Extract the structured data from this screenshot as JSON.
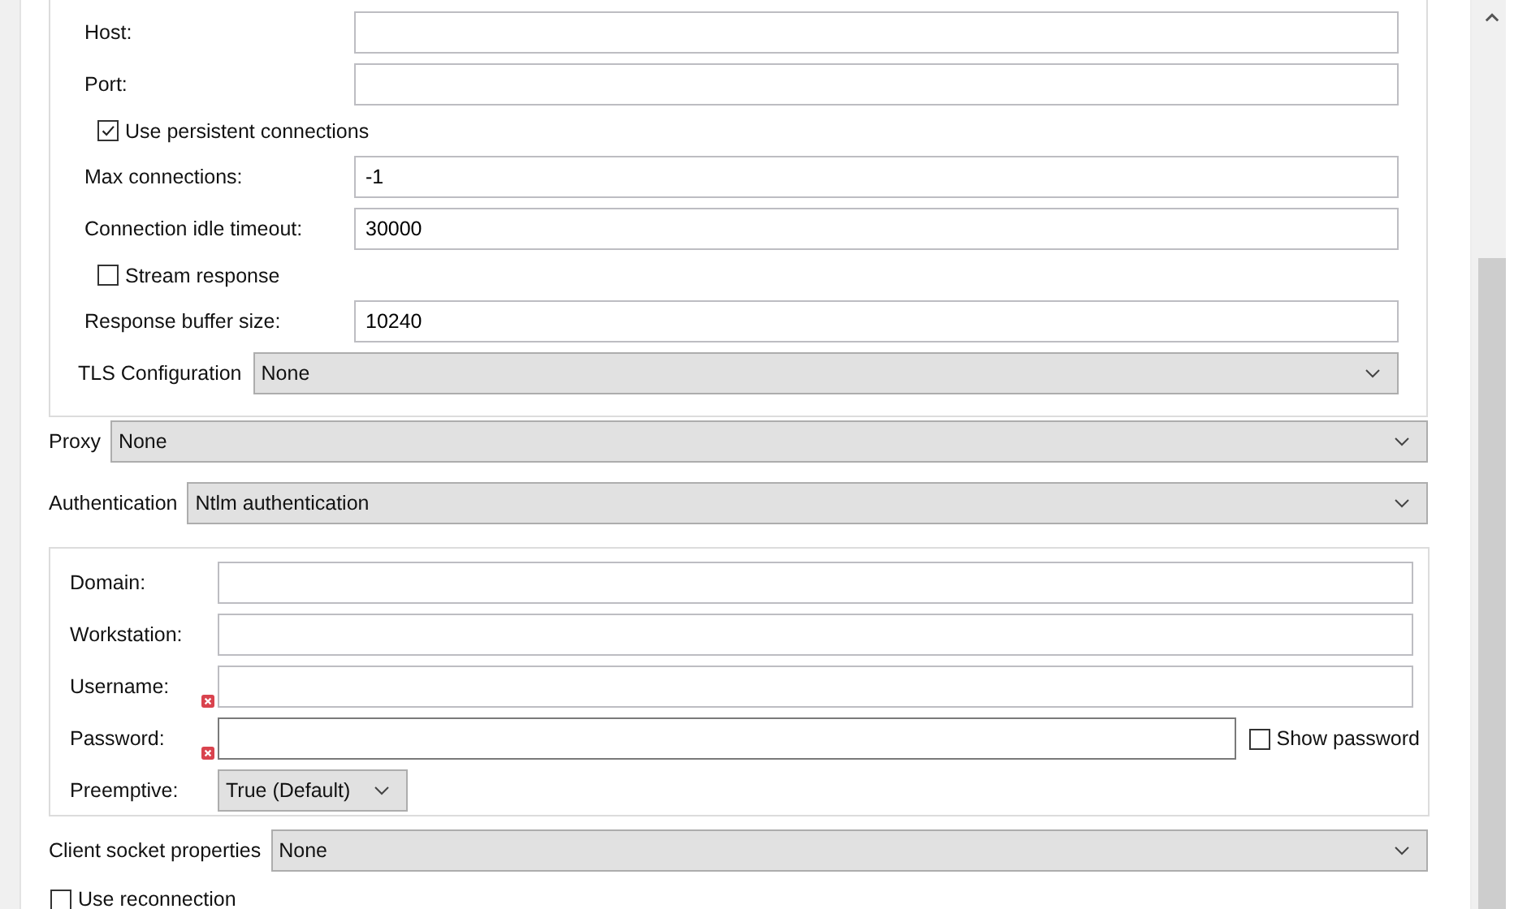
{
  "connection_settings": [
    {
      "kind": "text",
      "label": "Host:"
    },
    {
      "kind": "text",
      "label": "Port:"
    },
    {
      "kind": "checkbox",
      "label": "Use persistent connections",
      "checked": true
    },
    {
      "kind": "text",
      "label": "Max connections:",
      "value": "-1"
    },
    {
      "kind": "text",
      "label": "Connection idle timeout:",
      "value": "30000"
    },
    {
      "kind": "checkbox",
      "label": "Stream response",
      "checked": false
    },
    {
      "kind": "text",
      "label": "Response buffer size:",
      "value": "10240"
    },
    {
      "kind": "select",
      "label": "TLS Configuration",
      "value": "None"
    }
  ],
  "proxy": {
    "label": "Proxy",
    "value": "None"
  },
  "authentication": {
    "label": "Authentication",
    "value": "Ntlm authentication"
  },
  "authentication_settings": [
    {
      "kind": "text",
      "label": "Domain:",
      "error": false
    },
    {
      "kind": "text",
      "label": "Workstation:",
      "error": false
    },
    {
      "kind": "text",
      "label": "Username:",
      "error": true
    },
    {
      "kind": "password",
      "label": "Password:",
      "error": true,
      "show_password": {
        "label": "Show password",
        "checked": false
      }
    },
    {
      "kind": "select",
      "label": "Preemptive:",
      "value": "True (Default)"
    }
  ],
  "client_socket_properties": {
    "label": "Client socket properties",
    "value": "None"
  },
  "use_reconnection": {
    "label": "Use reconnection",
    "checked": false
  }
}
